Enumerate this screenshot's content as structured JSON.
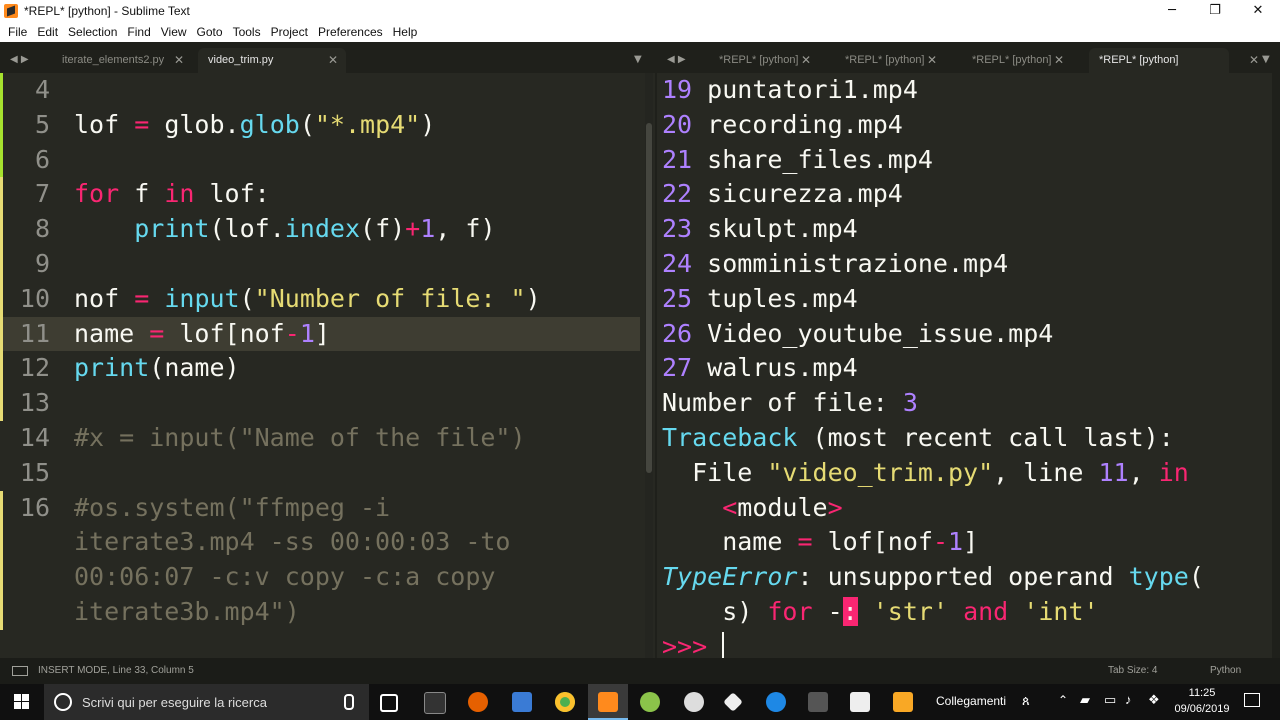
{
  "window": {
    "title": "*REPL* [python] - Sublime Text",
    "minimize": "─",
    "maximize": "❐",
    "close": "✕"
  },
  "menu": [
    "File",
    "Edit",
    "Selection",
    "Find",
    "View",
    "Goto",
    "Tools",
    "Project",
    "Preferences",
    "Help"
  ],
  "left_tabs": [
    {
      "label": "iterate_elements2.py",
      "active": false
    },
    {
      "label": "video_trim.py",
      "active": true
    }
  ],
  "right_tabs": [
    {
      "label": "*REPL* [python]"
    },
    {
      "label": "*REPL* [python]"
    },
    {
      "label": "*REPL* [python]"
    },
    {
      "label": "*REPL* [python]"
    }
  ],
  "editor": {
    "lines": [
      {
        "n": "4",
        "html": ""
      },
      {
        "n": "5",
        "html": "lof <span class='kw'>=</span> glob.<span class='fn'>glob</span>(<span class='str'>\"*.mp4\"</span>)"
      },
      {
        "n": "6",
        "html": ""
      },
      {
        "n": "7",
        "html": "<span class='kw'>for</span> f <span class='kw'>in</span> lof:"
      },
      {
        "n": "8",
        "html": "    <span class='fn'>print</span>(lof.<span class='fn'>index</span>(f)<span class='kw'>+</span><span class='num'>1</span>, f)"
      },
      {
        "n": "9",
        "html": ""
      },
      {
        "n": "10",
        "html": "nof <span class='kw'>=</span> <span class='fn'>input</span>(<span class='str'>\"Number of file: \"</span>)"
      },
      {
        "n": "11",
        "html": "name <span class='kw'>=</span> lof[nof<span class='kw'>-</span><span class='num'>1</span>]"
      },
      {
        "n": "12",
        "html": "<span class='fn'>print</span>(name)"
      },
      {
        "n": "13",
        "html": ""
      },
      {
        "n": "14",
        "html": "<span class='cmt'>#x = input(\"Name of the file\")</span>"
      },
      {
        "n": "15",
        "html": ""
      },
      {
        "n": "16",
        "html": "<span class='cmt'>#os.system(\"ffmpeg -i</span>"
      },
      {
        "n": "",
        "html": "<span class='cmt'>iterate3.mp4 -ss 00:00:03 -to</span>"
      },
      {
        "n": "",
        "html": "<span class='cmt'>00:06:07 -c:v copy -c:a copy</span>"
      },
      {
        "n": "",
        "html": "<span class='cmt'>iterate3b.mp4\")</span>"
      }
    ]
  },
  "repl": {
    "lines": [
      "<span class='num'>19</span> puntatori1.mp4",
      "<span class='num'>20</span> recording.mp4",
      "<span class='num'>21</span> share_files.mp4",
      "<span class='num'>22</span> sicurezza.mp4",
      "<span class='num'>23</span> skulpt.mp4",
      "<span class='num'>24</span> somministrazione.mp4",
      "<span class='num'>25</span> tuples.mp4",
      "<span class='num'>26</span> Video_youtube_issue.mp4",
      "<span class='num'>27</span> walrus.mp4",
      "Number of file: <span class='num'>3</span>",
      "<span class='fn'>Traceback</span> (most recent call last):",
      "  File <span class='str'>\"video_trim.py\"</span>, line <span class='num'>11</span>, <span class='kw'>in</span>",
      "    <span class='kw'>&lt;</span>module<span class='kw'>&gt;</span>",
      "    name <span class='kw'>=</span> lof[nof<span class='kw'>-</span><span class='num'>1</span>]",
      "<span class='ital'>TypeError</span>: unsupported operand <span class='fn'>type</span>(",
      "    s) <span class='kw'>for</span> -<span style='background:#f92672;color:#f8f8f2'>:</span> <span class='str'>'str'</span> <span class='kw'>and</span> <span class='str'>'int'</span>",
      "<span class='kw'>&gt;&gt;&gt;</span> <span style='border-left:2px solid #f8f8f2'></span>"
    ]
  },
  "status": {
    "left": "INSERT MODE, Line 33, Column 5",
    "tabsize": "Tab Size: 4",
    "syntax": "Python"
  },
  "taskbar": {
    "search": "Scrivi qui per eseguire la ricerca",
    "links": "Collegamenti",
    "time": "11:25",
    "date": "09/06/2019"
  }
}
